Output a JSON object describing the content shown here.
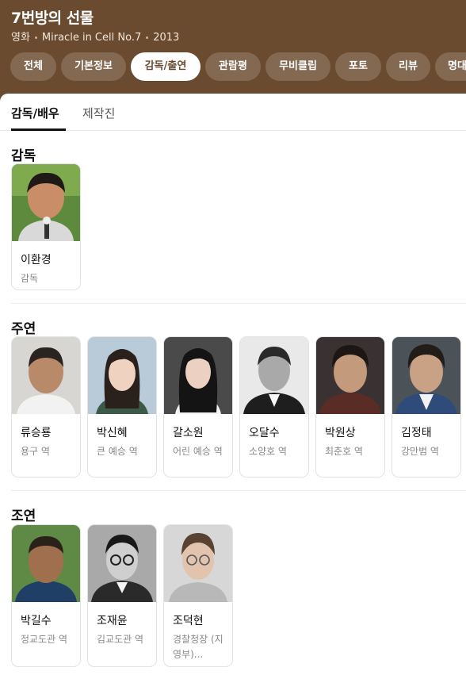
{
  "header": {
    "title": "7번방의 선물",
    "category": "영화",
    "original_title": "Miracle in Cell No.7",
    "year": "2013",
    "background_color": "#6a4b30"
  },
  "tabs": [
    {
      "label": "전체",
      "active": false
    },
    {
      "label": "기본정보",
      "active": false
    },
    {
      "label": "감독/출연",
      "active": true
    },
    {
      "label": "관람평",
      "active": false
    },
    {
      "label": "무비클립",
      "active": false
    },
    {
      "label": "포토",
      "active": false
    },
    {
      "label": "리뷰",
      "active": false
    },
    {
      "label": "명대",
      "active": false
    }
  ],
  "subtabs": [
    {
      "label": "감독/배우",
      "active": true
    },
    {
      "label": "제작진",
      "active": false
    }
  ],
  "sections": {
    "director": {
      "title": "감독",
      "people": [
        {
          "name": "이환경",
          "role": "감독"
        }
      ]
    },
    "lead": {
      "title": "주연",
      "people": [
        {
          "name": "류승룡",
          "role": "용구 역"
        },
        {
          "name": "박신혜",
          "role": "큰 예승 역"
        },
        {
          "name": "갈소원",
          "role": "어린 예승 역"
        },
        {
          "name": "오달수",
          "role": "소양호 역"
        },
        {
          "name": "박원상",
          "role": "최춘호 역"
        },
        {
          "name": "김정태",
          "role": "강만범 역"
        }
      ]
    },
    "supporting": {
      "title": "조연",
      "people": [
        {
          "name": "박길수",
          "role": "정교도관 역"
        },
        {
          "name": "조재윤",
          "role": "김교도관 역"
        },
        {
          "name": "조덕현",
          "role": "경찰청장 (지영부)..."
        }
      ]
    }
  }
}
